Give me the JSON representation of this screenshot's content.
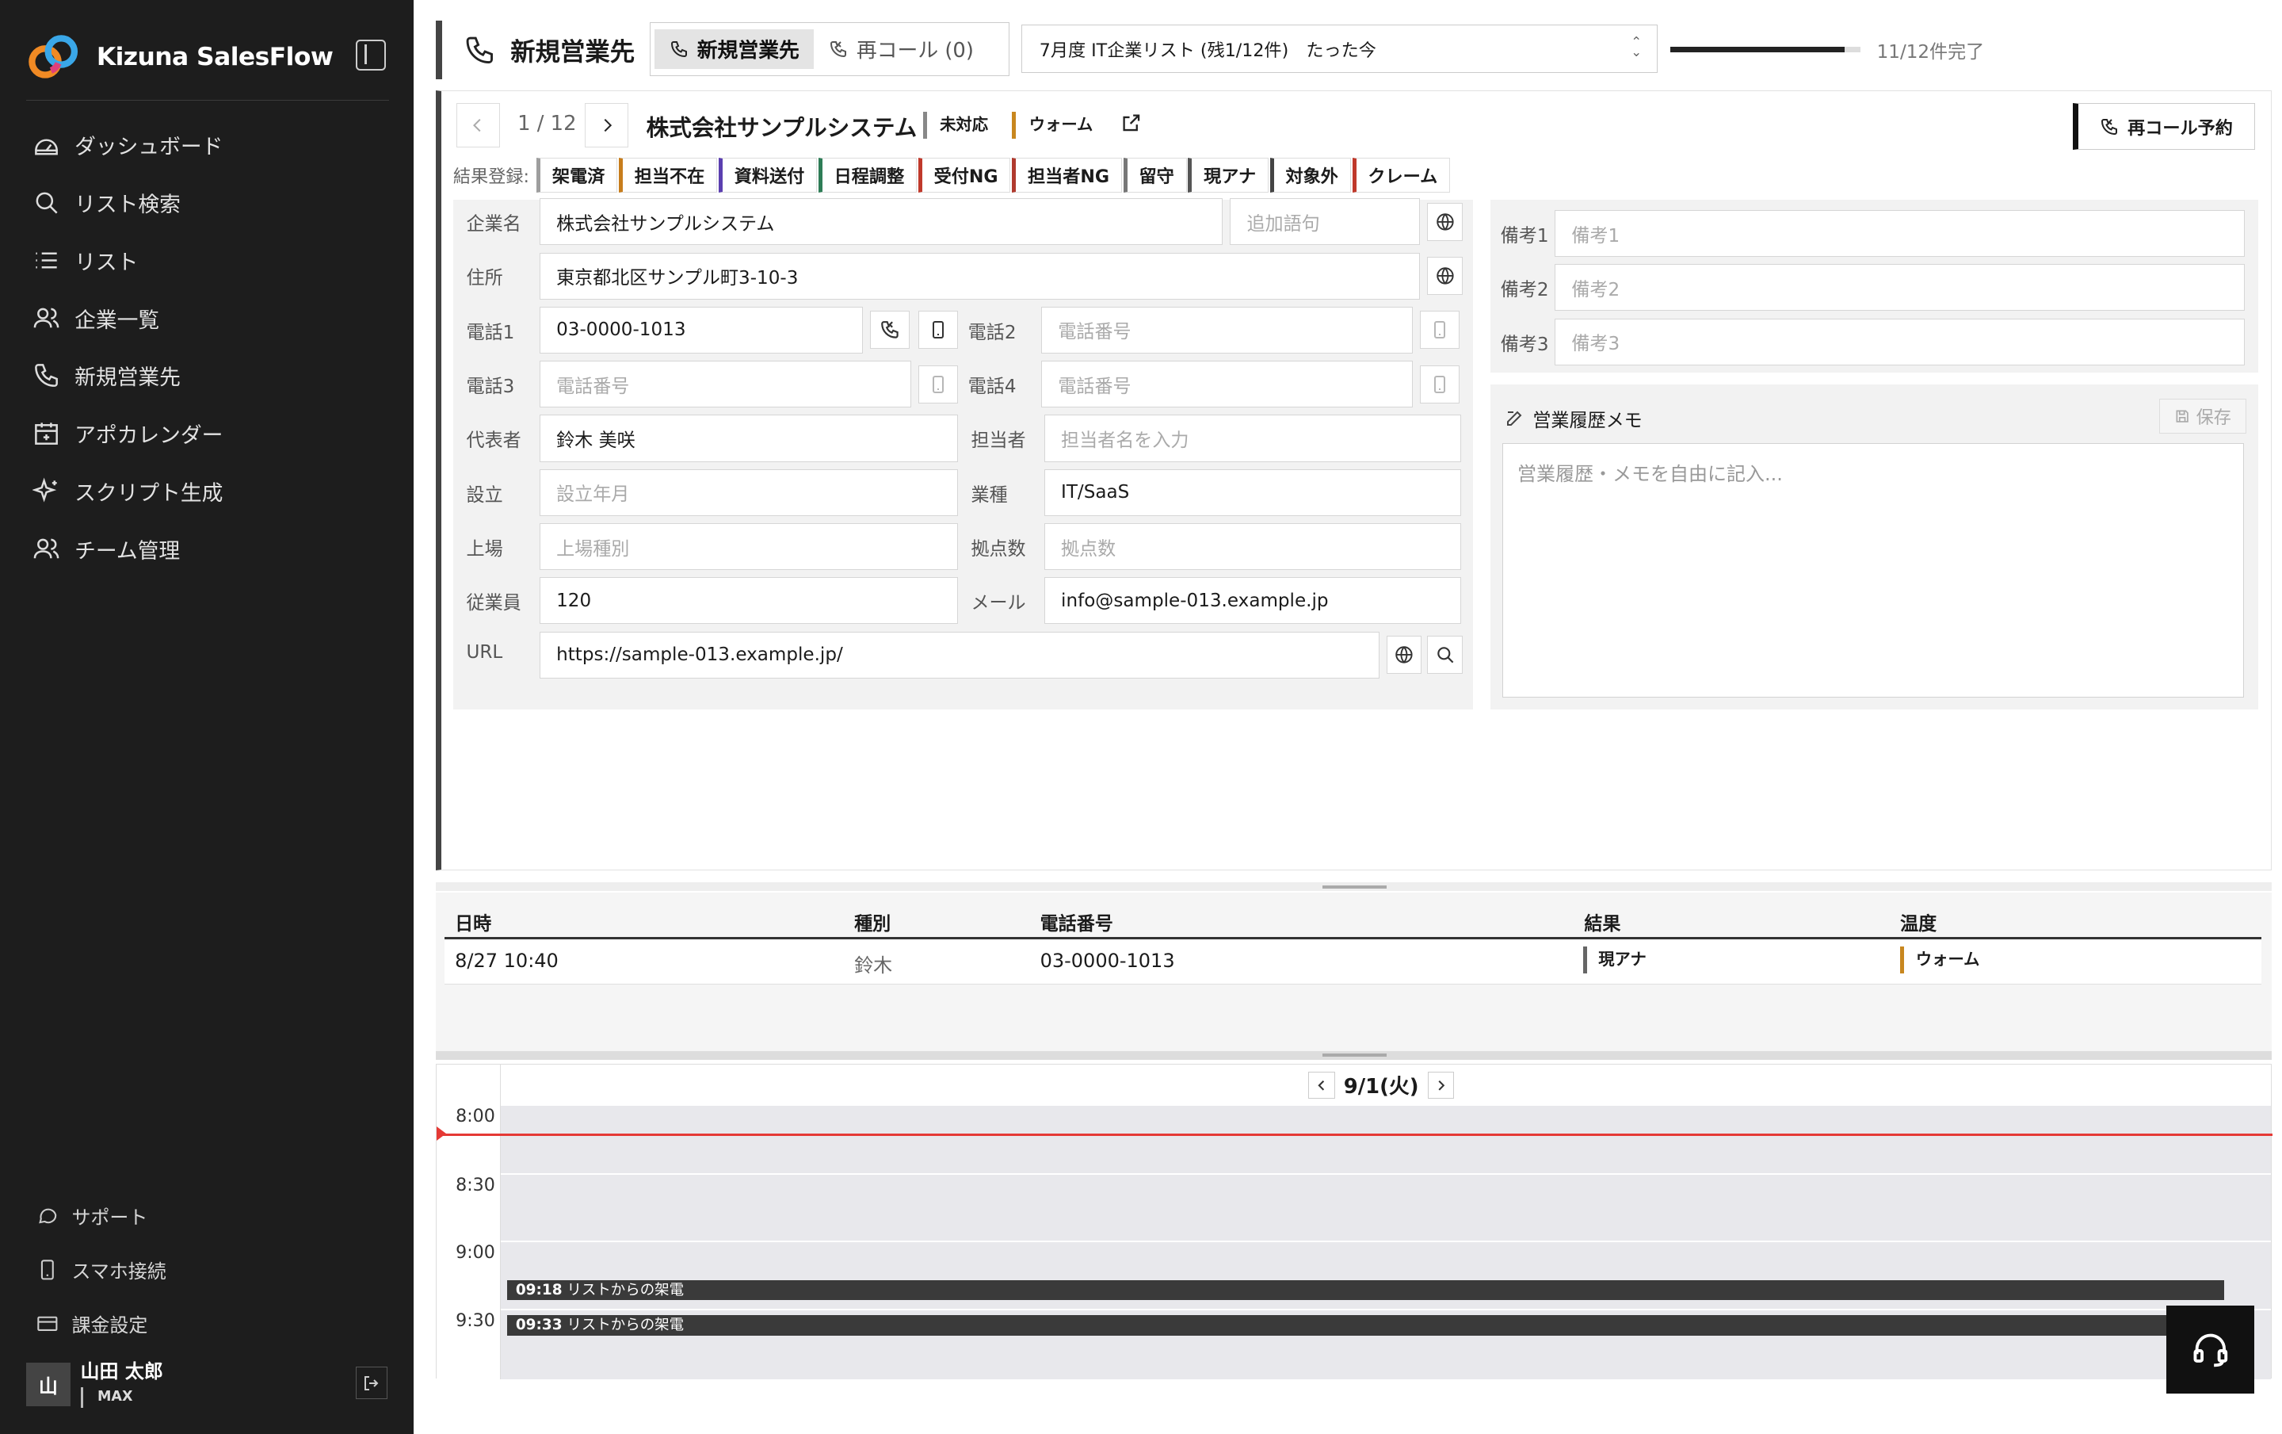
{
  "app": {
    "name": "Kizuna SalesFlow"
  },
  "nav": [
    {
      "label": "ダッシュボード",
      "icon": "dashboard-icon"
    },
    {
      "label": "リスト検索",
      "icon": "search-icon"
    },
    {
      "label": "リスト",
      "icon": "list-icon"
    },
    {
      "label": "企業一覧",
      "icon": "users-icon"
    },
    {
      "label": "新規営業先",
      "icon": "phone-icon"
    },
    {
      "label": "アポカレンダー",
      "icon": "calendar-icon"
    },
    {
      "label": "スクリプト生成",
      "icon": "sparkle-icon"
    },
    {
      "label": "チーム管理",
      "icon": "team-icon"
    }
  ],
  "sidebar_bottom": {
    "support": "サポート",
    "mobile": "スマホ接続",
    "billing": "課金設定"
  },
  "user": {
    "avatar": "山",
    "name": "山田 太郎",
    "plan": "MAX"
  },
  "header": {
    "title": "新規営業先",
    "tab_new": "新規営業先",
    "tab_recall": "再コール (0)",
    "list_select": "7月度 IT企業リスト (残1/12件)　たった今",
    "progress_text": "11/12件完了",
    "progress_fraction": 0.917
  },
  "record": {
    "counter": "1 / 12",
    "company": "株式会社サンプルシステム",
    "status": "未対応",
    "temperature": "ウォーム",
    "recall_button": "再コール予約"
  },
  "results": {
    "label": "結果登録:",
    "buttons": [
      {
        "label": "架電済",
        "color": "#9e9e9e"
      },
      {
        "label": "担当不在",
        "color": "#c77d1c"
      },
      {
        "label": "資料送付",
        "color": "#5b3fb0"
      },
      {
        "label": "日程調整",
        "color": "#2e7d57"
      },
      {
        "label": "受付NG",
        "color": "#c0392b"
      },
      {
        "label": "担当者NG",
        "color": "#b03a2e"
      },
      {
        "label": "留守",
        "color": "#777777"
      },
      {
        "label": "現アナ",
        "color": "#555555"
      },
      {
        "label": "対象外",
        "color": "#444444"
      },
      {
        "label": "クレーム",
        "color": "#c0392b"
      }
    ]
  },
  "form": {
    "company": {
      "label": "企業名",
      "value": "株式会社サンプルシステム",
      "extra_placeholder": "追加語句"
    },
    "address": {
      "label": "住所",
      "value": "東京都北区サンプル町3-10-3"
    },
    "tel1": {
      "label": "電話1",
      "value": "03-0000-1013"
    },
    "tel2": {
      "label": "電話2",
      "placeholder": "電話番号"
    },
    "tel3": {
      "label": "電話3",
      "placeholder": "電話番号"
    },
    "tel4": {
      "label": "電話4",
      "placeholder": "電話番号"
    },
    "rep": {
      "label": "代表者",
      "value": "鈴木 美咲"
    },
    "person": {
      "label": "担当者",
      "placeholder": "担当者名を入力"
    },
    "founded": {
      "label": "設立",
      "placeholder": "設立年月"
    },
    "industry": {
      "label": "業種",
      "value": "IT/SaaS"
    },
    "listed": {
      "label": "上場",
      "placeholder": "上場種別"
    },
    "offices": {
      "label": "拠点数",
      "placeholder": "拠点数"
    },
    "employees": {
      "label": "従業員",
      "value": "120"
    },
    "email": {
      "label": "メール",
      "value": "info@sample-013.example.jp"
    },
    "url": {
      "label": "URL",
      "value": "https://sample-013.example.jp/"
    }
  },
  "notes": [
    {
      "label": "備考1",
      "placeholder": "備考1"
    },
    {
      "label": "備考2",
      "placeholder": "備考2"
    },
    {
      "label": "備考3",
      "placeholder": "備考3"
    }
  ],
  "memo": {
    "title": "営業履歴メモ",
    "save": "保存",
    "placeholder": "営業履歴・メモを自由に記入..."
  },
  "history": {
    "headers": [
      "日時",
      "種別",
      "電話番号",
      "結果",
      "温度"
    ],
    "rows": [
      {
        "datetime": "8/27 10:40",
        "type": "鈴木",
        "phone": "03-0000-1013",
        "result": "現アナ",
        "temperature": "ウォーム"
      }
    ]
  },
  "calendar": {
    "date": "9/1(火)",
    "times": [
      "8:00",
      "8:30",
      "9:00",
      "9:30"
    ],
    "events": [
      {
        "time": "09:18",
        "title": "リストからの架電"
      },
      {
        "time": "09:33",
        "title": "リストからの架電"
      }
    ]
  }
}
